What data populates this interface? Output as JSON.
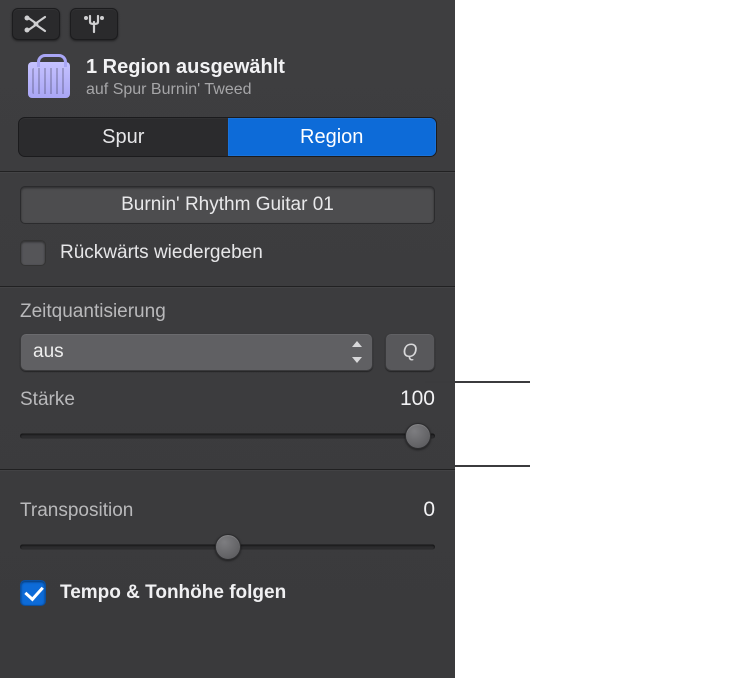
{
  "header": {
    "title": "1 Region ausgewählt",
    "subtitle": "auf Spur Burnin' Tweed"
  },
  "tabs": {
    "track": "Spur",
    "region": "Region"
  },
  "region_name": "Burnin' Rhythm Guitar 01",
  "reverse_label": "Rückwärts wiedergeben",
  "quantize": {
    "section_label": "Zeitquantisierung",
    "value": "aus",
    "q_button": "Q",
    "strength_label": "Stärke",
    "strength_value": "100"
  },
  "transpose": {
    "label": "Transposition",
    "value": "0"
  },
  "follow_label": "Tempo & Tonhöhe folgen"
}
